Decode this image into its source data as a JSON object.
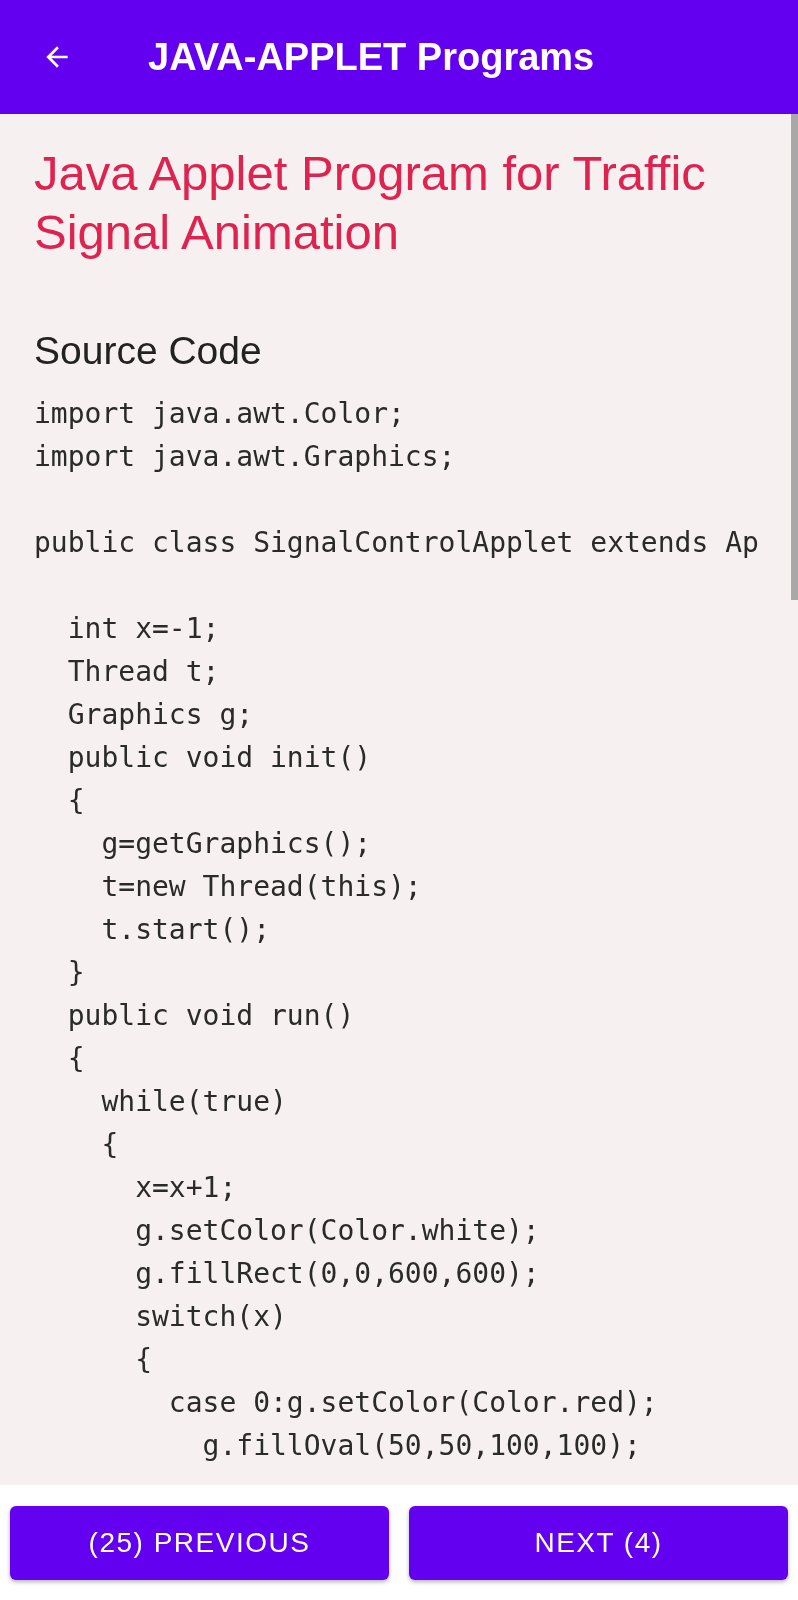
{
  "app_bar": {
    "title": "JAVA-APPLET Programs"
  },
  "article": {
    "title": "Java Applet Program for Traffic Signal Animation",
    "section_heading": "Source Code",
    "code_lines": [
      {
        "kind": "code",
        "text": "import java.awt.Color;"
      },
      {
        "kind": "code",
        "text": "import java.awt.Graphics;"
      },
      {
        "kind": "blank"
      },
      {
        "kind": "code",
        "text": "public class SignalControlApplet extends Ap",
        "children": [
          {
            "kind": "blank"
          },
          {
            "kind": "code",
            "text": "int x=-1;"
          },
          {
            "kind": "code",
            "text": "Thread t;"
          },
          {
            "kind": "code",
            "text": "Graphics g;"
          },
          {
            "kind": "code",
            "text": "public void init()"
          },
          {
            "kind": "code",
            "text": "{",
            "children": [
              {
                "kind": "code",
                "text": "g=getGraphics();"
              },
              {
                "kind": "code",
                "text": "t=new Thread(this);"
              },
              {
                "kind": "code",
                "text": "t.start();"
              }
            ]
          },
          {
            "kind": "code",
            "text": "}"
          },
          {
            "kind": "code",
            "text": "public void run()"
          },
          {
            "kind": "code",
            "text": "{",
            "children": [
              {
                "kind": "code",
                "text": "while(true)"
              },
              {
                "kind": "code",
                "text": "{",
                "children": [
                  {
                    "kind": "code",
                    "text": "x=x+1;"
                  },
                  {
                    "kind": "code",
                    "text": "g.setColor(Color.white);"
                  },
                  {
                    "kind": "code",
                    "text": "g.fillRect(0,0,600,600);"
                  },
                  {
                    "kind": "code",
                    "text": "switch(x)"
                  },
                  {
                    "kind": "code",
                    "text": "{",
                    "children": [
                      {
                        "kind": "code",
                        "text": "case 0:g.setColor(Color.red);",
                        "children": [
                          {
                            "kind": "code",
                            "text": "g.fillOval(50,50,100,100);"
                          }
                        ]
                      }
                    ]
                  }
                ]
              }
            ]
          }
        ]
      }
    ]
  },
  "buttons": [
    {
      "label": "(25) PREVIOUS"
    },
    {
      "label": "NEXT (4)"
    }
  ]
}
